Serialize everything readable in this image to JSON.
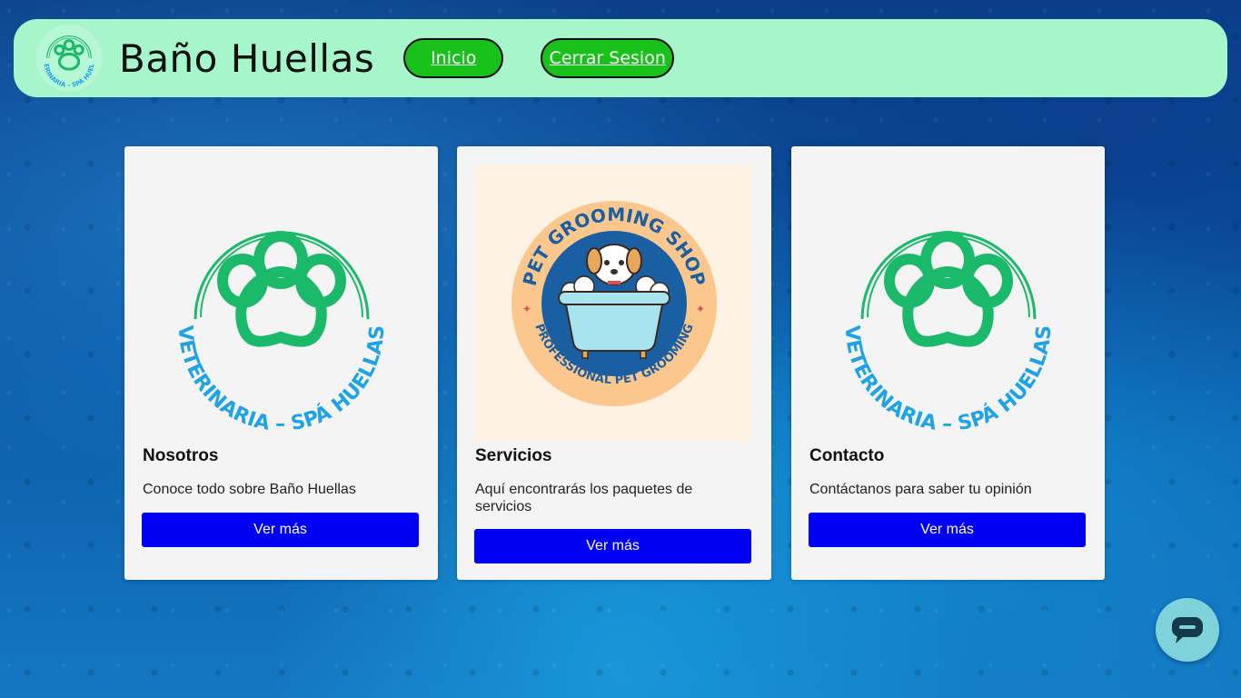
{
  "header": {
    "logo_text": "VETERINARIA – SPÁ HUELLAS",
    "site_title": "Baño Huellas",
    "nav": [
      {
        "label": "Inicio"
      },
      {
        "label": "Cerrar Sesion"
      }
    ]
  },
  "cards": [
    {
      "image_logo_text": "VETERINARIA – SPÁ HUELLAS",
      "title": "Nosotros",
      "text": "Conoce todo sobre Baño Huellas",
      "button": "Ver más"
    },
    {
      "image_top_text": "PET GROOMING SHOP",
      "image_bottom_text": "PROFESSIONAL PET GROOMING",
      "title": "Servicios",
      "text": "Aquí encontrarás los paquetes de servicios",
      "button": "Ver más"
    },
    {
      "image_logo_text": "VETERINARIA – SPÁ HUELLAS",
      "title": "Contacto",
      "text": "Contáctanos para saber tu opinión",
      "button": "Ver más"
    }
  ],
  "colors": {
    "header_bg": "#a6f5cb",
    "nav_button_bg": "#19c21b",
    "card_button_bg": "#0000f2",
    "paw_green": "#1bb96a",
    "logo_blue": "#1fa3e8",
    "chat_widget_bg": "#7fd2d9"
  },
  "icons": {
    "logo": "paw-logo-icon",
    "chat": "chat-bubble-icon"
  }
}
